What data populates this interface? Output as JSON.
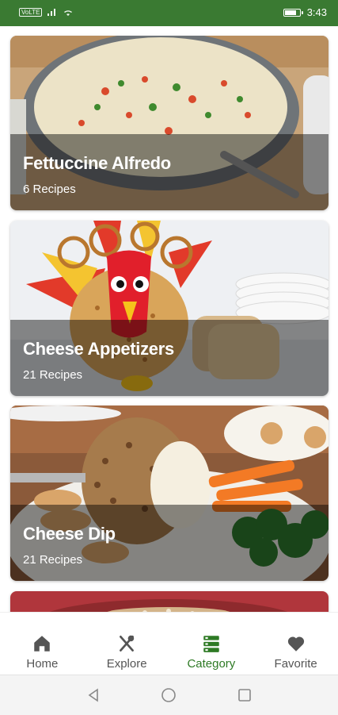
{
  "status_bar": {
    "left_text": "VoLTE",
    "time": "3:43",
    "icons": [
      "signal-icon",
      "wifi-icon",
      "battery-icon"
    ],
    "color": "#3a7a32"
  },
  "categories": [
    {
      "title": "Fettuccine Alfredo",
      "count": "6 Recipes"
    },
    {
      "title": "Cheese Appetizers",
      "count": "21 Recipes"
    },
    {
      "title": "Cheese Dip",
      "count": "21 Recipes"
    },
    {
      "title": "",
      "count": ""
    }
  ],
  "bottom_nav": {
    "items": [
      {
        "label": "Home",
        "icon": "home-icon"
      },
      {
        "label": "Explore",
        "icon": "utensils-icon"
      },
      {
        "label": "Category",
        "icon": "category-icon",
        "active": true
      },
      {
        "label": "Favorite",
        "icon": "heart-icon"
      }
    ],
    "active_color": "#2e7a25"
  },
  "system_nav": {
    "buttons": [
      "back-button",
      "home-button",
      "recents-button"
    ]
  }
}
